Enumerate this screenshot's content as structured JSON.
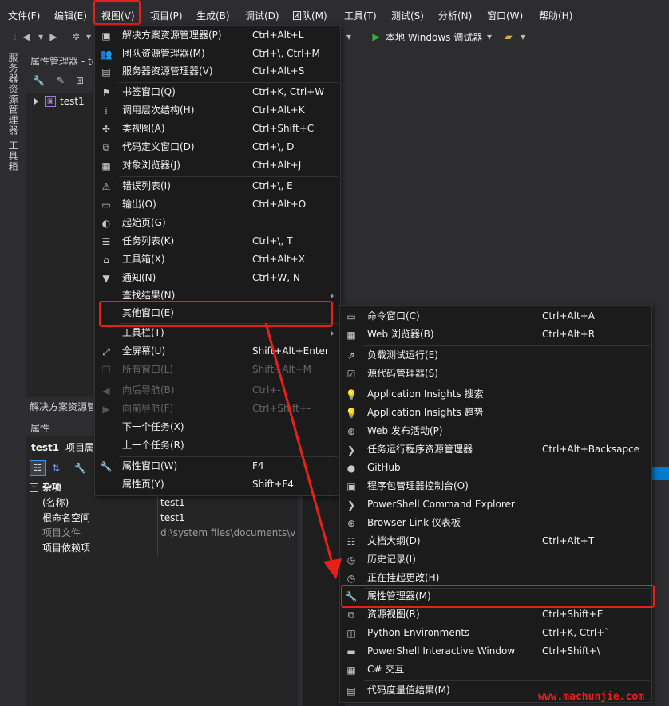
{
  "menubar": {
    "items": [
      "文件(F)",
      "编辑(E)",
      "视图(V)",
      "项目(P)",
      "生成(B)",
      "调试(D)",
      "团队(M)",
      "工具(T)",
      "测试(S)",
      "分析(N)",
      "窗口(W)",
      "帮助(H)"
    ]
  },
  "toolbar": {
    "debug_target": "本地 Windows 调试器"
  },
  "side_strip": {
    "server_explorer": "服务器资源管理器",
    "toolbox": "工具箱"
  },
  "property_manager": {
    "title": "属性管理器 - te",
    "tree_item": "test1"
  },
  "solution_explorer_tab": "解决方案资源管",
  "properties": {
    "title": "属性",
    "object": "test1",
    "object_type": "项目属性",
    "category": "杂项",
    "rows": [
      {
        "name": "(名称)",
        "value": "test1",
        "dim": false
      },
      {
        "name": "根命名空间",
        "value": "test1",
        "dim": false
      },
      {
        "name": "项目文件",
        "value": "d:\\system files\\documents\\vis",
        "dim": true
      },
      {
        "name": "项目依赖项",
        "value": "",
        "dim": false
      }
    ]
  },
  "view_menu": {
    "items": [
      {
        "label": "解决方案资源管理器(P)",
        "shortcut": "Ctrl+Alt+L",
        "icon": "solution-explorer-icon",
        "glyph": "▣"
      },
      {
        "label": "团队资源管理器(M)",
        "shortcut": "Ctrl+\\, Ctrl+M",
        "icon": "team-explorer-icon",
        "glyph": "👥"
      },
      {
        "label": "服务器资源管理器(V)",
        "shortcut": "Ctrl+Alt+S",
        "icon": "server-explorer-icon",
        "glyph": "▤"
      },
      {
        "label": "书签窗口(Q)",
        "shortcut": "Ctrl+K, Ctrl+W",
        "icon": "bookmark-icon",
        "glyph": "⚑"
      },
      {
        "label": "调用层次结构(H)",
        "shortcut": "Ctrl+Alt+K",
        "icon": "call-hierarchy-icon",
        "glyph": "⁞"
      },
      {
        "label": "类视图(A)",
        "shortcut": "Ctrl+Shift+C",
        "icon": "class-view-icon",
        "glyph": "✣"
      },
      {
        "label": "代码定义窗口(D)",
        "shortcut": "Ctrl+\\, D",
        "icon": "code-definition-icon",
        "glyph": "⧉"
      },
      {
        "label": "对象浏览器(J)",
        "shortcut": "Ctrl+Alt+J",
        "icon": "object-browser-icon",
        "glyph": "▦"
      },
      {
        "label": "错误列表(I)",
        "shortcut": "Ctrl+\\, E",
        "icon": "error-list-icon",
        "glyph": "⚠"
      },
      {
        "label": "输出(O)",
        "shortcut": "Ctrl+Alt+O",
        "icon": "output-icon",
        "glyph": "▭"
      },
      {
        "label": "起始页(G)",
        "shortcut": "",
        "icon": "start-page-icon",
        "glyph": "◐"
      },
      {
        "label": "任务列表(K)",
        "shortcut": "Ctrl+\\, T",
        "icon": "task-list-icon",
        "glyph": "☰"
      },
      {
        "label": "工具箱(X)",
        "shortcut": "Ctrl+Alt+X",
        "icon": "toolbox-icon",
        "glyph": "⌂"
      },
      {
        "label": "通知(N)",
        "shortcut": "Ctrl+W, N",
        "icon": "notification-icon",
        "glyph": "▼"
      },
      {
        "label": "查找结果(N)",
        "shortcut": "",
        "icon": "",
        "glyph": ""
      },
      {
        "label": "其他窗口(E)",
        "shortcut": "",
        "icon": "",
        "glyph": ""
      },
      {
        "label": "工具栏(T)",
        "shortcut": "",
        "icon": "",
        "glyph": ""
      },
      {
        "label": "全屏幕(U)",
        "shortcut": "Shift+Alt+Enter",
        "icon": "fullscreen-icon",
        "glyph": "⤢"
      },
      {
        "label": "所有窗口(L)",
        "shortcut": "Shift+Alt+M",
        "icon": "all-windows-icon",
        "glyph": "❐"
      },
      {
        "label": "向后导航(B)",
        "shortcut": "Ctrl+-",
        "icon": "navigate-back-icon",
        "glyph": "◀"
      },
      {
        "label": "向前导航(F)",
        "shortcut": "Ctrl+Shift+-",
        "icon": "navigate-forward-icon",
        "glyph": "▶"
      },
      {
        "label": "下一个任务(X)",
        "shortcut": "",
        "icon": "",
        "glyph": ""
      },
      {
        "label": "上一个任务(R)",
        "shortcut": "",
        "icon": "",
        "glyph": ""
      },
      {
        "label": "属性窗口(W)",
        "shortcut": "F4",
        "icon": "wrench-icon",
        "glyph": "🔧"
      },
      {
        "label": "属性页(Y)",
        "shortcut": "Shift+F4",
        "icon": "",
        "glyph": ""
      }
    ]
  },
  "other_windows_menu": {
    "items": [
      {
        "label": "命令窗口(C)",
        "shortcut": "Ctrl+Alt+A",
        "icon": "command-window-icon",
        "glyph": "▭"
      },
      {
        "label": "Web 浏览器(B)",
        "shortcut": "Ctrl+Alt+R",
        "icon": "web-browser-icon",
        "glyph": "▦"
      },
      {
        "label": "负载测试运行(E)",
        "shortcut": "",
        "icon": "load-test-icon",
        "glyph": "⇗"
      },
      {
        "label": "源代码管理器(S)",
        "shortcut": "",
        "icon": "source-control-icon",
        "glyph": "☑"
      },
      {
        "label": "Application Insights 搜索",
        "shortcut": "",
        "icon": "app-insights-search-icon",
        "glyph": "💡"
      },
      {
        "label": "Application Insights 趋势",
        "shortcut": "",
        "icon": "app-insights-trends-icon",
        "glyph": "💡"
      },
      {
        "label": "Web 发布活动(P)",
        "shortcut": "",
        "icon": "web-publish-icon",
        "glyph": "⊕"
      },
      {
        "label": "任务运行程序资源管理器",
        "shortcut": "Ctrl+Alt+Backsapce",
        "icon": "task-runner-icon",
        "glyph": "❯"
      },
      {
        "label": "GitHub",
        "shortcut": "",
        "icon": "github-icon",
        "glyph": "●"
      },
      {
        "label": "程序包管理器控制台(O)",
        "shortcut": "",
        "icon": "package-console-icon",
        "glyph": "▣"
      },
      {
        "label": "PowerShell Command Explorer",
        "shortcut": "",
        "icon": "powershell-icon",
        "glyph": "❯"
      },
      {
        "label": "Browser Link 仪表板",
        "shortcut": "",
        "icon": "browser-link-icon",
        "glyph": "⊕"
      },
      {
        "label": "文档大纲(D)",
        "shortcut": "Ctrl+Alt+T",
        "icon": "document-outline-icon",
        "glyph": "☷"
      },
      {
        "label": "历史记录(I)",
        "shortcut": "",
        "icon": "history-icon",
        "glyph": "◷"
      },
      {
        "label": "正在挂起更改(H)",
        "shortcut": "",
        "icon": "pending-changes-icon",
        "glyph": "◷"
      },
      {
        "label": "属性管理器(M)",
        "shortcut": "",
        "icon": "wrench-icon",
        "glyph": "🔧"
      },
      {
        "label": "资源视图(R)",
        "shortcut": "Ctrl+Shift+E",
        "icon": "resource-view-icon",
        "glyph": "⧉"
      },
      {
        "label": "Python Environments",
        "shortcut": "Ctrl+K, Ctrl+`",
        "icon": "python-env-icon",
        "glyph": "◫"
      },
      {
        "label": "PowerShell Interactive Window",
        "shortcut": "Ctrl+Shift+\\",
        "icon": "powershell-window-icon",
        "glyph": "▬"
      },
      {
        "label": "C# 交互",
        "shortcut": "",
        "icon": "csharp-interactive-icon",
        "glyph": "▦"
      },
      {
        "label": "代码度量值结果(M)",
        "shortcut": "",
        "icon": "code-metrics-icon",
        "glyph": "▤"
      }
    ]
  },
  "watermark": "www.machunjie.com"
}
